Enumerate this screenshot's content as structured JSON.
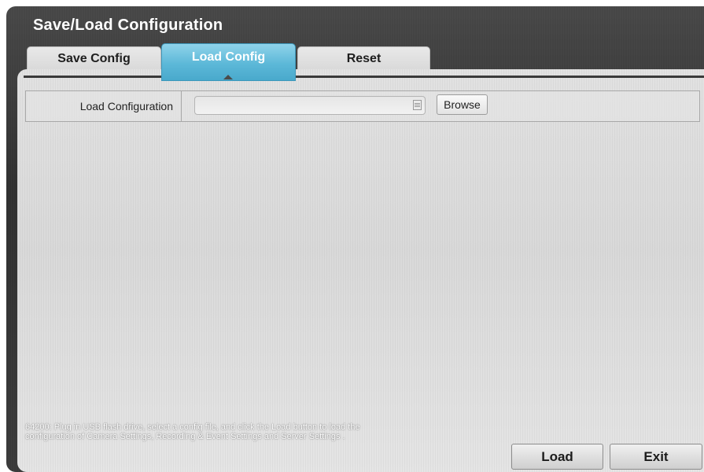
{
  "window": {
    "title": "Save/Load Configuration"
  },
  "tabs": [
    {
      "label": "Save Config",
      "active": false
    },
    {
      "label": "Load Config",
      "active": true
    },
    {
      "label": "Reset",
      "active": false
    }
  ],
  "load_form": {
    "label": "Load Configuration",
    "file_value": "",
    "browse_label": "Browse",
    "file_icon": "document-icon"
  },
  "hint": {
    "text": "64200: Plug in USB flash drive, select a config file, and click the Load button to load the configuration of Camera Settings, Recording & Event Settings and Server Settings ."
  },
  "actions": {
    "load_label": "Load",
    "exit_label": "Exit"
  },
  "colors": {
    "active_tab": "#5cb8d8",
    "frame": "#333333",
    "panel": "#dddddd"
  }
}
